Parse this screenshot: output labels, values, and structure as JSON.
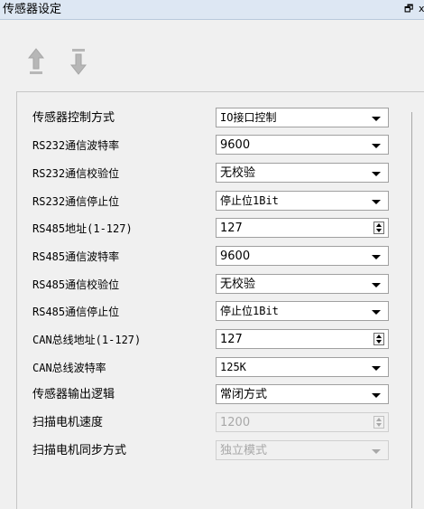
{
  "window": {
    "title": "传感器设定",
    "pin_glyph": "🗗",
    "close_glyph": "x"
  },
  "toolbar": {
    "move_up_icon": "arrow-up-icon",
    "move_down_icon": "arrow-down-icon"
  },
  "settings": [
    {
      "label": "传感器控制方式",
      "value": "IO接口控制",
      "control": "dropdown",
      "enabled": true
    },
    {
      "label": "RS232通信波特率",
      "value": "9600",
      "control": "dropdown",
      "enabled": true
    },
    {
      "label": "RS232通信校验位",
      "value": "无校验",
      "control": "dropdown",
      "enabled": true
    },
    {
      "label": "RS232通信停止位",
      "value": "停止位1Bit",
      "control": "dropdown",
      "enabled": true
    },
    {
      "label": "RS485地址(1-127)",
      "value": "127",
      "control": "spinbox",
      "enabled": true
    },
    {
      "label": "RS485通信波特率",
      "value": "9600",
      "control": "dropdown",
      "enabled": true
    },
    {
      "label": "RS485通信校验位",
      "value": "无校验",
      "control": "dropdown",
      "enabled": true
    },
    {
      "label": "RS485通信停止位",
      "value": "停止位1Bit",
      "control": "dropdown",
      "enabled": true
    },
    {
      "label": "CAN总线地址(1-127)",
      "value": "127",
      "control": "spinbox",
      "enabled": true
    },
    {
      "label": "CAN总线波特率",
      "value": "125K",
      "control": "dropdown",
      "enabled": true
    },
    {
      "label": "传感器输出逻辑",
      "value": "常闭方式",
      "control": "dropdown",
      "enabled": true
    },
    {
      "label": "扫描电机速度",
      "value": "1200",
      "control": "spinbox",
      "enabled": false
    },
    {
      "label": "扫描电机同步方式",
      "value": "独立模式",
      "control": "dropdown",
      "enabled": false
    }
  ],
  "colors": {
    "titlebar": "#dde7f3",
    "arrow_disabled": "#b7b7b7",
    "disabled_text": "#a8a8a8"
  }
}
